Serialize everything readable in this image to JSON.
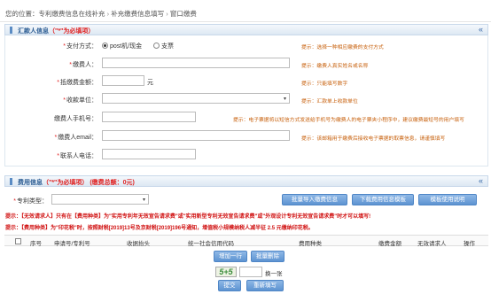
{
  "breadcrumb": {
    "location_label": "您的位置：",
    "items": [
      "专利缴费信息在线补充",
      "补充缴费信息填写",
      "窗口缴费"
    ]
  },
  "remitter_panel": {
    "title_main": "汇款人信息",
    "title_note": "（\"*\"为必填项）",
    "fields": {
      "payment_method": {
        "label": "支付方式：",
        "options": [
          "post机/现金",
          "支票"
        ],
        "selected": "post机/现金",
        "hint": "提示：选择一种相应缴费的支付方式"
      },
      "payer": {
        "label": "缴费人：",
        "value": "",
        "hint": "提示：缴费人真实姓名或名称"
      },
      "amount": {
        "label": "抵缴费金额：",
        "value": "",
        "unit": "元",
        "hint": "提示：只能填写数字"
      },
      "payee_unit": {
        "label": "收款单位：",
        "value": "",
        "hint": "提示：汇款单上收款单位"
      },
      "phone": {
        "label": "缴费人手机号：",
        "value": "",
        "hint": "提示：电子票据将以短信方式发送给手机号为缴费人的电子票夹小程序中，建议缴费最短号的用户填写"
      },
      "email": {
        "label": "缴费人email：",
        "value": "",
        "hint": "提示：该邮箱用于缴费后接收电子票据的取票信息，请谨慎填写"
      },
      "contact_phone": {
        "label": "联系人电话：",
        "value": ""
      }
    }
  },
  "fee_panel": {
    "title_main": "费用信息",
    "title_note": "（\"*\"为必填项）",
    "total": "(缴费总额：0元)",
    "fee_type_label": "专利类型：",
    "fee_type_value": "",
    "buttons": {
      "batch_import": "批量导入缴费信息",
      "download_template": "下载费用信息模板",
      "template_usage": "模板使用说明"
    },
    "warnings": [
      "提示：【无效请求人】只有在【费用种类】为\"实用专利年无效宣告请求费\"或\"实用新型专利无效宣告请求费\"或\"外观设计专利无效宣告请求费\"时才可以填写!",
      "提示：【费用种类】为\"印花税\"时，按照财税[2019]13号及京财税[2019]196号通知，增值税小规模纳税人减半征 2.5 元缴纳印花税。"
    ],
    "table_headers": [
      "序号",
      "申请号/专利号",
      "收据抬头",
      "统一社会信用代码",
      "费用种类",
      "缴费金额",
      "无效请求人",
      "操作"
    ],
    "rows": []
  },
  "actions": {
    "add_row": "增加一行",
    "batch_delete": "批量删除",
    "captcha_text": "5+5",
    "captcha_refresh": "换一张",
    "submit": "提交",
    "reset": "重新填写"
  }
}
